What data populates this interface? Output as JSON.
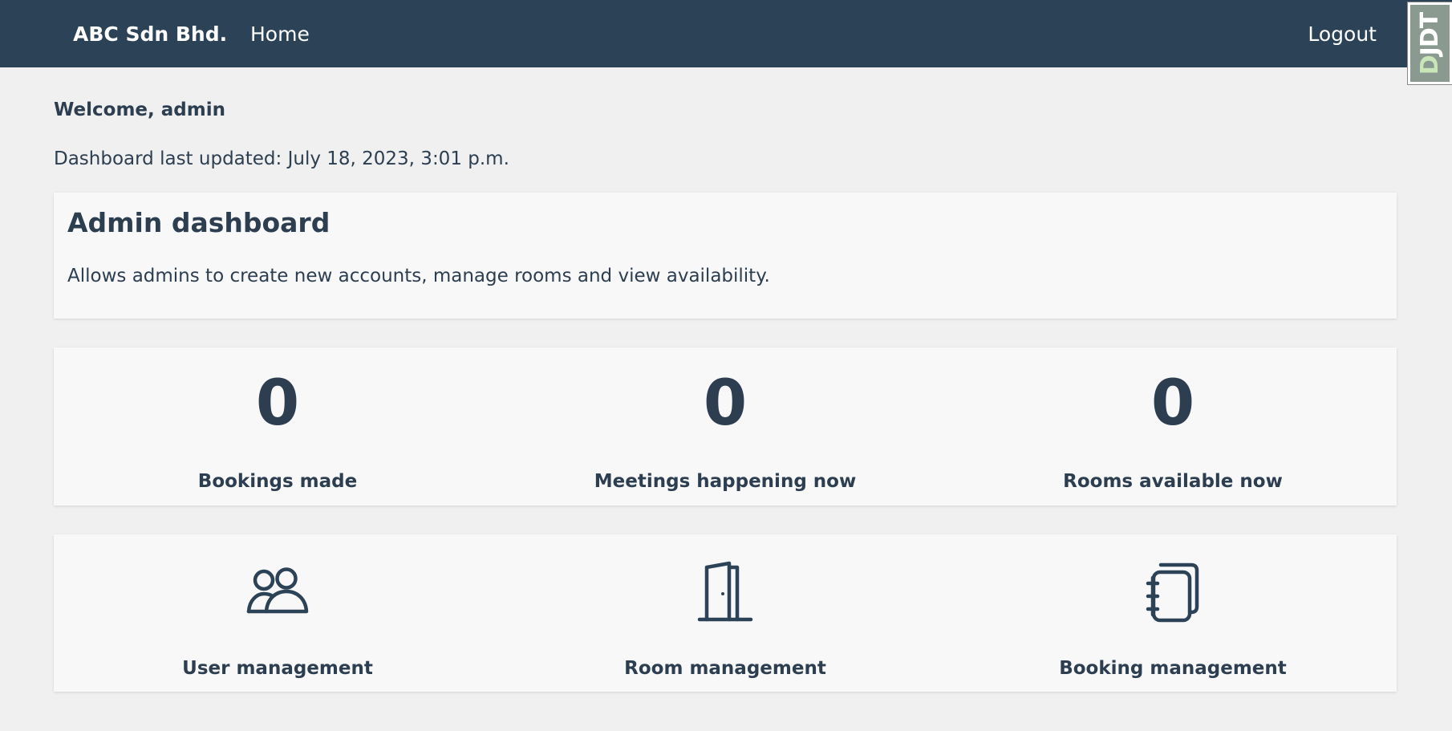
{
  "navbar": {
    "brand": "ABC Sdn Bhd.",
    "home_label": "Home",
    "logout_label": "Logout",
    "background": "#2c4357"
  },
  "debug_toolbar": {
    "label_part1": "D",
    "label_part2": "JDT"
  },
  "welcome": "Welcome, admin",
  "last_updated": "Dashboard last updated: July 18, 2023, 3:01 p.m.",
  "intro": {
    "title": "Admin dashboard",
    "description": "Allows admins to create new accounts, manage rooms and view availability."
  },
  "stats": [
    {
      "value": "0",
      "label": "Bookings made"
    },
    {
      "value": "0",
      "label": "Meetings happening now"
    },
    {
      "value": "0",
      "label": "Rooms available now"
    }
  ],
  "actions": [
    {
      "label": "User management",
      "icon": "users-icon"
    },
    {
      "label": "Room management",
      "icon": "door-icon"
    },
    {
      "label": "Booking management",
      "icon": "notebook-icon"
    }
  ],
  "colors": {
    "text": "#2c3e50",
    "page_bg": "#f0f0f0",
    "card_bg": "#f8f8f8"
  }
}
